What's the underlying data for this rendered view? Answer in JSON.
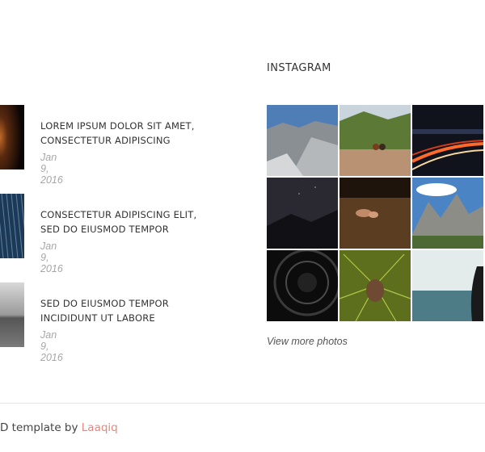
{
  "posts": [
    {
      "title_line1": "LOREM IPSUM DOLOR SIT AMET,",
      "title_line2": "CONSECTETUR ADIPISCING",
      "date": "Jan 9, 2016"
    },
    {
      "title_line1": "CONSECTETUR ADIPISCING ELIT,",
      "title_line2": "SED DO EIUSMOD TEMPOR",
      "date": "Jan 9, 2016"
    },
    {
      "title_line1": "SED DO EIUSMOD TEMPOR",
      "title_line2": "INCIDIDUNT UT LABORE",
      "date": "Jan 9, 2016"
    }
  ],
  "instagram": {
    "heading": "INSTAGRAM",
    "more_label": "View more photos"
  },
  "footer": {
    "text": "D template by ",
    "link_label": "Laaqiq",
    "link_color": "#e8867c"
  }
}
